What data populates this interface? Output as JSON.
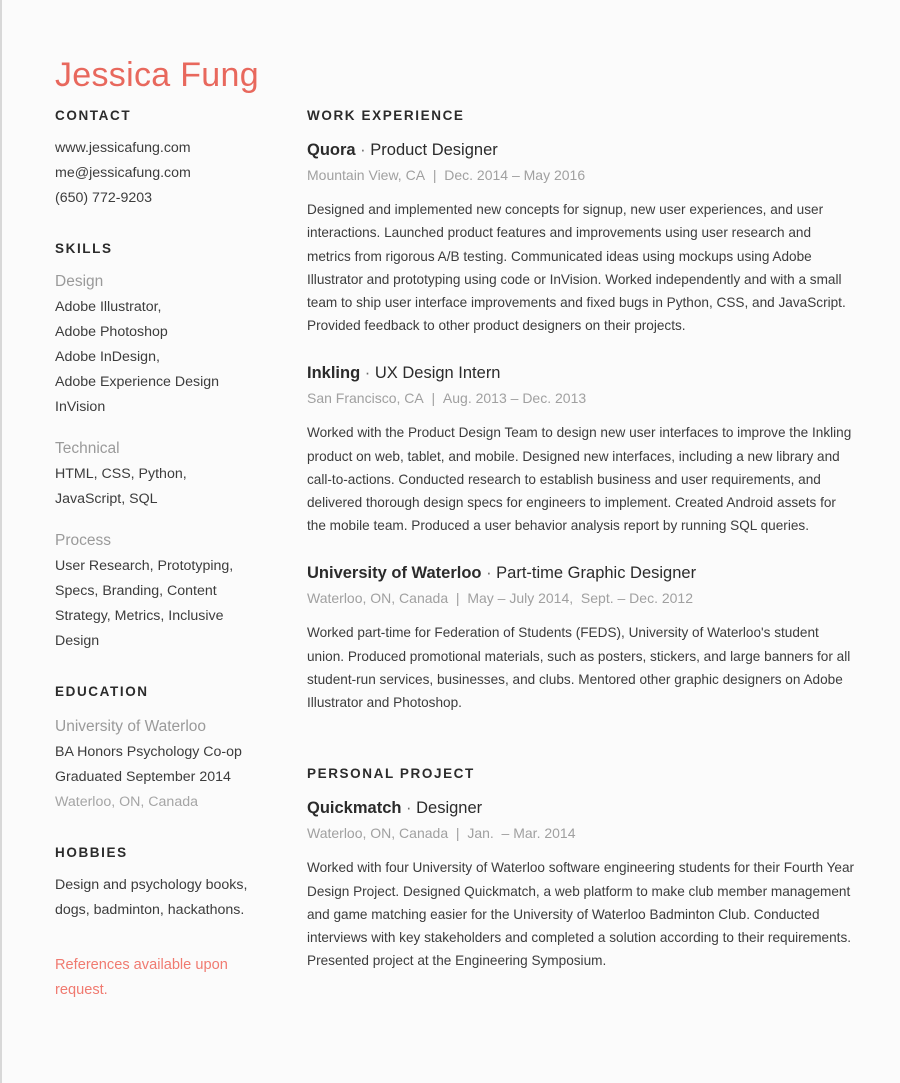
{
  "header": {
    "name": "Jessica Fung",
    "accent_color": "#e8685d"
  },
  "sidebar": {
    "contact": {
      "title": "CONTACT",
      "website": "www.jessicafung.com",
      "email": "me@jessicafung.com",
      "phone": "(650) 772-9203"
    },
    "skills": {
      "title": "SKILLS",
      "groups": [
        {
          "label": "Design",
          "lines": [
            "Adobe Illustrator,",
            "Adobe Photoshop",
            "Adobe InDesign,",
            "Adobe Experience Design",
            "InVision"
          ]
        },
        {
          "label": "Technical",
          "lines": [
            "HTML, CSS, Python,",
            "JavaScript, SQL"
          ]
        },
        {
          "label": "Process",
          "lines": [
            "User Research, Prototyping,",
            "Specs, Branding, Content",
            "Strategy, Metrics, Inclusive",
            "Design"
          ]
        }
      ]
    },
    "education": {
      "title": "EDUCATION",
      "school": "University of Waterloo",
      "degree": "BA Honors Psychology Co-op",
      "graduated": "Graduated September 2014",
      "location": "Waterloo, ON, Canada"
    },
    "hobbies": {
      "title": "HOBBIES",
      "lines": [
        "Design and psychology books,",
        "dogs, badminton, hackathons."
      ]
    },
    "references": "References available upon request."
  },
  "main": {
    "work_title": "WORK EXPERIENCE",
    "project_title": "PERSONAL PROJECT",
    "work": [
      {
        "org": "Quora",
        "separator": " · ",
        "role": "Product Designer",
        "location": "Mountain View, CA",
        "divider": "|",
        "dates": "Dec. 2014 – May 2016",
        "description": "Designed and implemented new concepts for signup, new user experiences, and user interactions. Launched product features and improvements using user research and metrics from rigorous A/B testing. Communicated ideas using mockups using Adobe Illustrator and prototyping using code or InVision. Worked independently and with a small team to ship user interface improvements and fixed bugs in Python, CSS, and JavaScript. Provided feedback to other product designers on their projects."
      },
      {
        "org": "Inkling",
        "separator": " · ",
        "role": "UX Design Intern",
        "location": "San Francisco, CA",
        "divider": "|",
        "dates": "Aug. 2013 – Dec. 2013",
        "description": "Worked with the Product Design Team to design new user interfaces to improve the Inkling product on web, tablet, and mobile. Designed new interfaces, including a new library and call-to-actions. Conducted research to establish business and user requirements, and delivered thorough design specs for engineers to implement. Created Android assets for the mobile team. Produced a user behavior analysis report by running SQL queries."
      },
      {
        "org": "University of Waterloo",
        "separator": " · ",
        "role": "Part-time Graphic Designer",
        "location": "Waterloo, ON, Canada",
        "divider": "|",
        "dates": "May – July 2014,  Sept. – Dec. 2012",
        "description": "Worked part-time for Federation of Students (FEDS), University of Waterloo's student union. Produced promotional materials, such as posters, stickers, and large banners for all student-run services, businesses, and clubs. Mentored other graphic designers on Adobe Illustrator and Photoshop."
      }
    ],
    "projects": [
      {
        "org": "Quickmatch",
        "separator": " · ",
        "role": "Designer",
        "location": "Waterloo, ON, Canada",
        "divider": "|",
        "dates": "Jan.  – Mar. 2014",
        "description": "Worked with four University of Waterloo software engineering students for their Fourth Year Design Project. Designed Quickmatch, a web platform to make club member management and game matching easier for the University of Waterloo Badminton Club. Conducted interviews with key stakeholders and completed a solution according to their requirements. Presented project at the Engineering Symposium."
      }
    ]
  }
}
